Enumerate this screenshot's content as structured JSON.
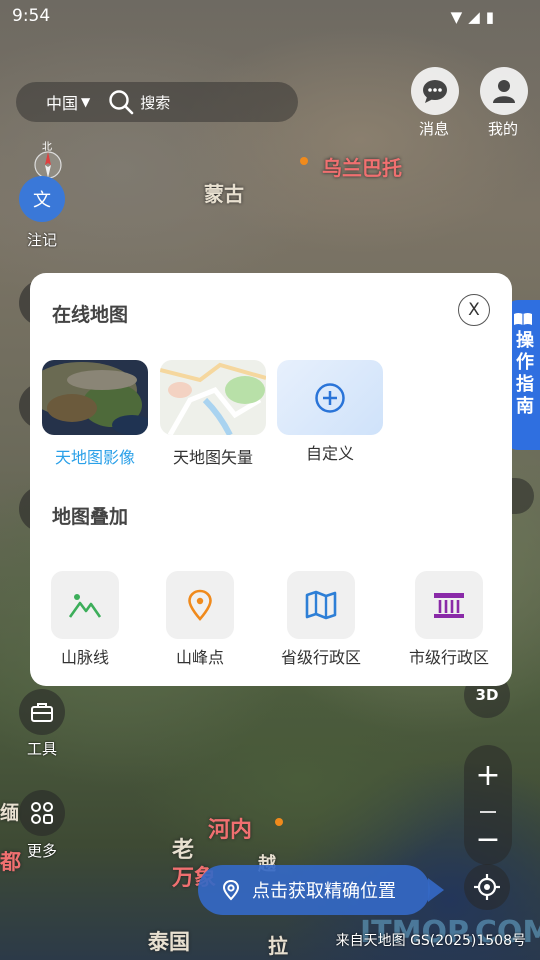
{
  "status_bar": {
    "time": "9:54"
  },
  "search": {
    "region": "中国",
    "placeholder": "搜索"
  },
  "top_buttons": {
    "messages_label": "消息",
    "profile_label": "我的"
  },
  "map_labels": {
    "ulaanbaatar": "乌兰巴托",
    "mongolia": "蒙古",
    "hanoi": "河内",
    "laos_1": "老",
    "laos_2": "万象",
    "thailand": "泰国",
    "cambodia": "拉",
    "myanmar_city": "都",
    "myanmar_2": "缅",
    "vietnam_2": "越"
  },
  "left_controls": {
    "annotation_label": "注记",
    "annotation_glyph": "文",
    "compass_n": "北",
    "tools_label": "工具",
    "more_label": "更多"
  },
  "guide": {
    "label": "操作指南"
  },
  "panel": {
    "online_title": "在线地图",
    "close_label": "X",
    "maps": [
      {
        "label": "天地图影像",
        "active": true
      },
      {
        "label": "天地图矢量",
        "active": false
      },
      {
        "label": "自定义",
        "active": false
      }
    ],
    "overlay_title": "地图叠加",
    "overlays": [
      {
        "label": "山脉线",
        "icon": "mountain-icon",
        "color": "#3cae5a"
      },
      {
        "label": "山峰点",
        "icon": "location-pin-icon",
        "color": "#f08a1c"
      },
      {
        "label": "省级行政区",
        "icon": "folded-map-icon",
        "color": "#2e7fd6"
      },
      {
        "label": "市级行政区",
        "icon": "government-building-icon",
        "color": "#8a2aa8"
      }
    ]
  },
  "right_controls": {
    "three_d_label": "3D",
    "zoom_in": "+",
    "zoom_out": "−"
  },
  "locate": {
    "label": "点击获取精确位置"
  },
  "credit": {
    "text": "来自天地图 GS(2025)1508号"
  },
  "watermark": {
    "text": "ITMOP.COM"
  }
}
